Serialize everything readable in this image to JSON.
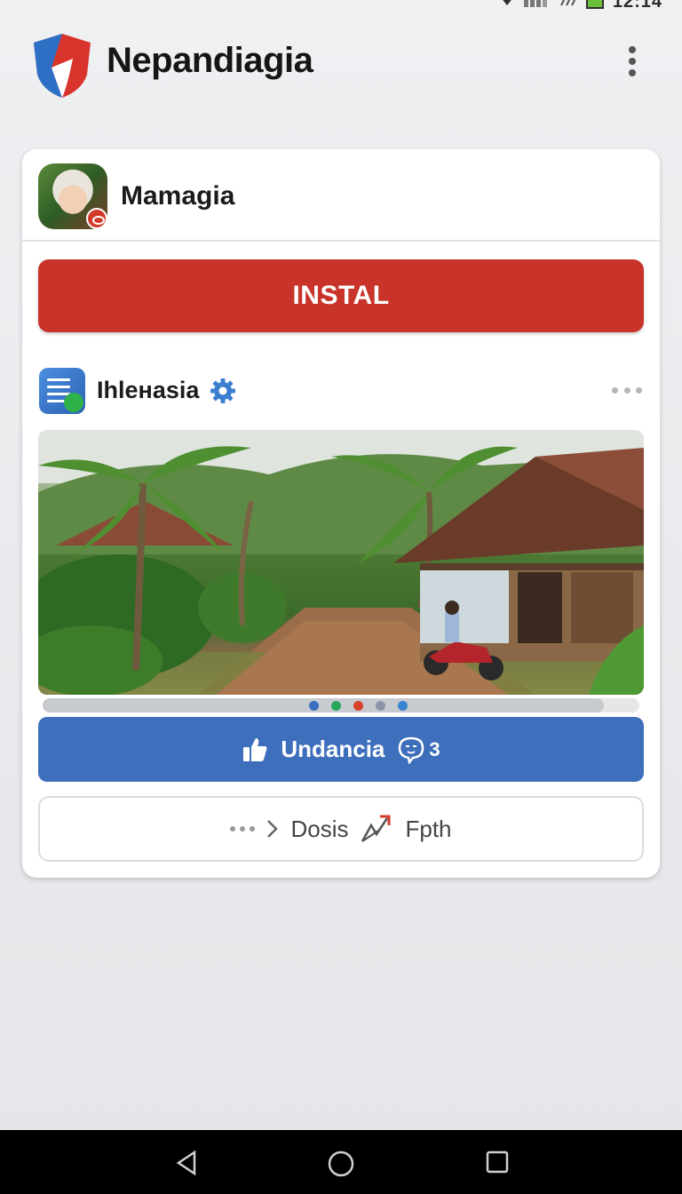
{
  "status_bar": {
    "time": "12:14"
  },
  "app_bar": {
    "title": "Nepandiagia",
    "logo_icon": "shield-icon",
    "menu_icon": "more-vertical-icon"
  },
  "card": {
    "account_name": "Mamagia",
    "install_label": "INSTAL",
    "post": {
      "source_name": "Ihlенasia",
      "verified_icon": "gear-badge-icon",
      "media_alt": "village-scene-photo"
    },
    "carousel": {
      "dots": [
        "#3d6fc0",
        "#27a85a",
        "#d8432e",
        "#8c96a8",
        "#3a84d2"
      ],
      "active_index": 2
    },
    "like_button": {
      "label": "Undancia",
      "comment_count": "3"
    },
    "action_row": {
      "share_label": "Dosis",
      "second_label": "Fpth"
    }
  },
  "colors": {
    "install": "#c8342a",
    "like": "#3e6fbc"
  }
}
